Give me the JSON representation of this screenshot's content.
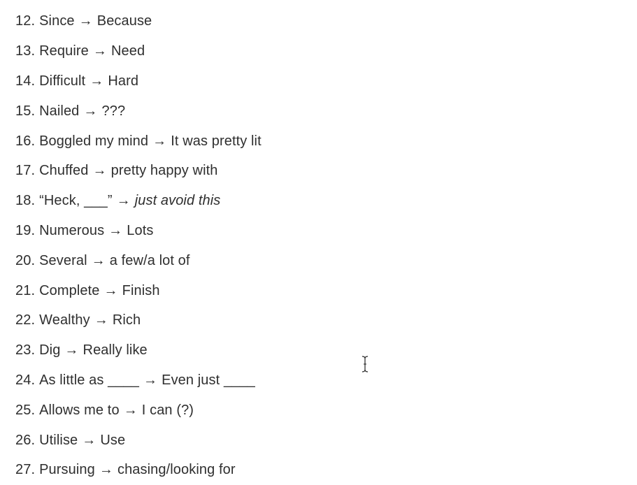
{
  "items": [
    {
      "num": "12.",
      "from": "Since",
      "arrow": "→",
      "to": "Because",
      "to_italic": false
    },
    {
      "num": "13.",
      "from": "Require",
      "arrow": "→",
      "to": "Need",
      "to_italic": false
    },
    {
      "num": "14.",
      "from": "Difficult",
      "arrow": "→",
      "to": "Hard",
      "to_italic": false
    },
    {
      "num": "15.",
      "from": "Nailed",
      "arrow": "→",
      "to": "???",
      "to_italic": false
    },
    {
      "num": "16.",
      "from": "Boggled my mind",
      "arrow": "→",
      "to": "It was pretty lit",
      "to_italic": false
    },
    {
      "num": "17.",
      "from": "Chuffed",
      "arrow": "→",
      "to": "pretty happy with",
      "to_italic": false
    },
    {
      "num": "18.",
      "from": "“Heck, ___”",
      "arrow": "→",
      "to": "just avoid this",
      "to_italic": true
    },
    {
      "num": "19.",
      "from": "Numerous",
      "arrow": "→",
      "to": "Lots",
      "to_italic": false
    },
    {
      "num": "20.",
      "from": "Several",
      "arrow": "→",
      "to": "a few/a lot of",
      "to_italic": false
    },
    {
      "num": "21.",
      "from": "Complete",
      "arrow": "→",
      "to": "Finish",
      "to_italic": false
    },
    {
      "num": "22.",
      "from": "Wealthy",
      "arrow": "→",
      "to": "Rich",
      "to_italic": false
    },
    {
      "num": "23.",
      "from": "Dig",
      "arrow": "→",
      "to": "Really like",
      "to_italic": false
    },
    {
      "num": "24.",
      "from": "As little as ____",
      "arrow": "→",
      "to": "Even just ____",
      "to_italic": false
    },
    {
      "num": "25.",
      "from": "Allows me to",
      "arrow": "→",
      "to": "I can (?)",
      "to_italic": false
    },
    {
      "num": "26.",
      "from": "Utilise",
      "arrow": "→",
      "to": "Use",
      "to_italic": false
    },
    {
      "num": "27.",
      "from": "Pursuing",
      "arrow": "→",
      "to": "chasing/looking for",
      "to_italic": false
    }
  ],
  "cursor_icon": "text-cursor-icon",
  "colors": {
    "text": "#2f2f2f",
    "background": "#ffffff"
  }
}
